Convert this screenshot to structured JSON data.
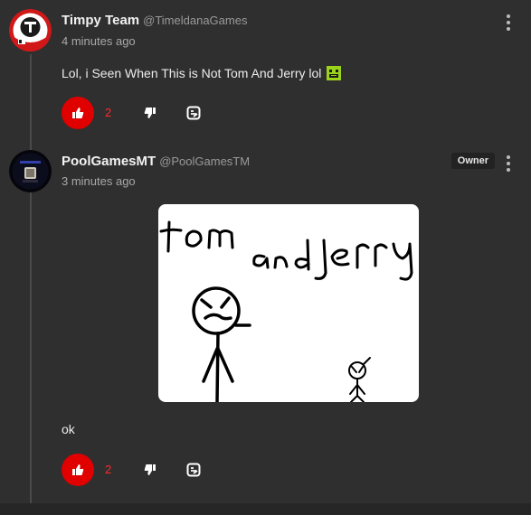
{
  "comments": [
    {
      "author": "Timpy Team",
      "handle": "@TimeldanaGames",
      "time": "4 minutes ago",
      "text": "Lol, i Seen When This is Not Tom And Jerry lol",
      "likes": "2",
      "avatar_icon": "timpy-logo-icon",
      "emoji_icon": "green-face-emoji-icon"
    },
    {
      "author": "PoolGamesMT",
      "handle": "@PoolGamesTM",
      "time": "3 minutes ago",
      "badge": "Owner",
      "text": "ok",
      "likes": "2",
      "avatar_icon": "poolgames-avatar-icon",
      "attachment": {
        "handwritten_title_1": "tom",
        "handwritten_title_2": "and jerry"
      }
    }
  ],
  "colors": {
    "background": "#2f2f2f",
    "like_red": "#e00000",
    "count_red": "#ff2a2a"
  }
}
